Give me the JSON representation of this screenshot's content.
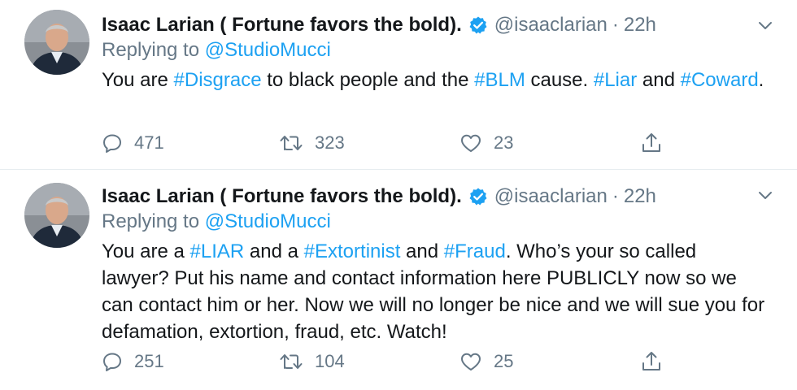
{
  "tweets": [
    {
      "author_name": "Isaac Larian ( Fortune favors the bold).",
      "handle": "@isaaclarian",
      "separator": "·",
      "time": "22h",
      "replying_prefix": "Replying to ",
      "replying_to": "@StudioMucci",
      "text_segments": [
        {
          "text": "You are ",
          "tag": false
        },
        {
          "text": "#Disgrace",
          "tag": true
        },
        {
          "text": " to black people and the ",
          "tag": false
        },
        {
          "text": "#BLM",
          "tag": true
        },
        {
          "text": " cause. ",
          "tag": false
        },
        {
          "text": "#Liar",
          "tag": true
        },
        {
          "text": " and ",
          "tag": false
        },
        {
          "text": "#Coward",
          "tag": true
        },
        {
          "text": ".",
          "tag": false
        }
      ],
      "replies": "471",
      "retweets": "323",
      "likes": "23"
    },
    {
      "author_name": "Isaac Larian ( Fortune favors the bold).",
      "handle": "@isaaclarian",
      "separator": "·",
      "time": "22h",
      "replying_prefix": "Replying to ",
      "replying_to": "@StudioMucci",
      "text_segments": [
        {
          "text": "You are a ",
          "tag": false
        },
        {
          "text": "#LIAR",
          "tag": true
        },
        {
          "text": " and a ",
          "tag": false
        },
        {
          "text": "#Extortinist",
          "tag": true
        },
        {
          "text": " and ",
          "tag": false
        },
        {
          "text": "#Fraud",
          "tag": true
        },
        {
          "text": ". Who’s your so called lawyer? Put his name and contact information here PUBLICLY now so we can contact him or her. Now we will no longer be nice and we will sue you for defamation, extortion, fraud, etc. Watch!",
          "tag": false
        }
      ],
      "replies": "251",
      "retweets": "104",
      "likes": "25"
    }
  ],
  "icons": {
    "verified": "verified-badge-icon",
    "caret": "chevron-down-icon",
    "reply": "reply-bubble-icon",
    "retweet": "retweet-icon",
    "like": "heart-icon",
    "share": "share-upload-icon"
  },
  "colors": {
    "link": "#1da1f2",
    "secondary_text": "#657786",
    "primary_text": "#14171a",
    "divider": "#e6ecf0"
  }
}
